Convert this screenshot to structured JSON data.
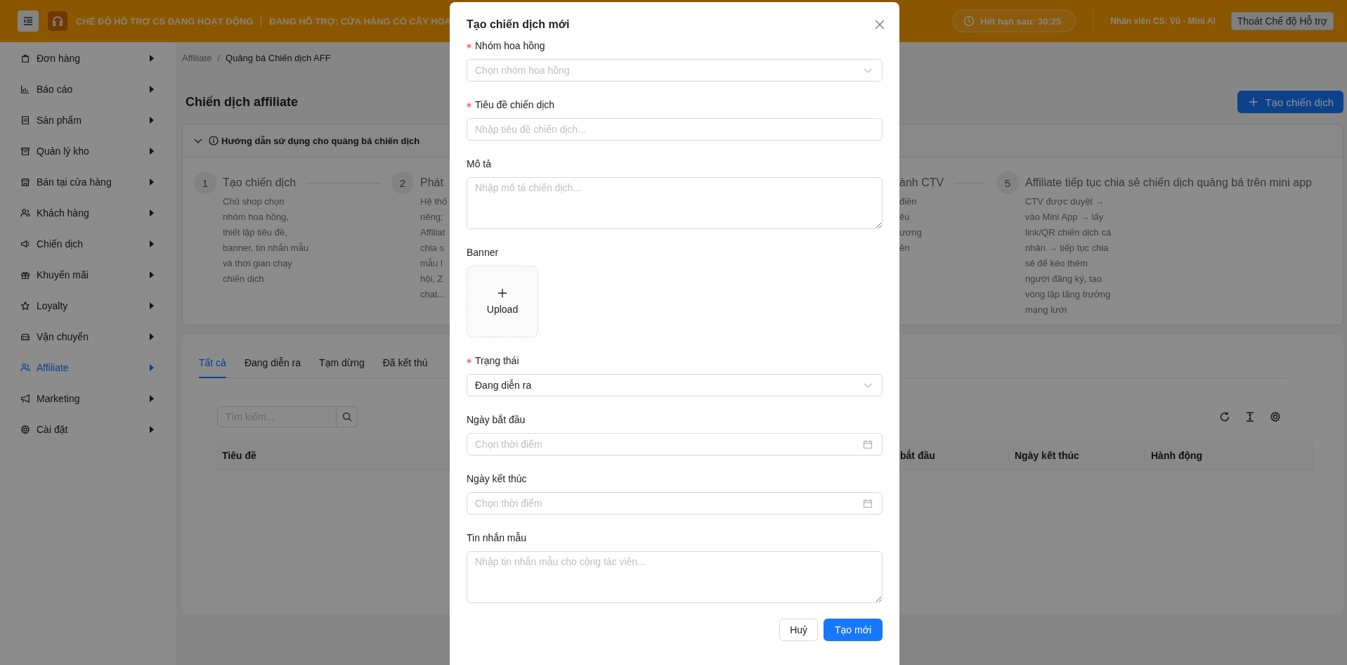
{
  "top_bar": {
    "mode_text": "CHẾ ĐỘ HỖ TRỢ CS ĐANG HOẠT ĐỘNG",
    "supporting_text": "ĐANG HỖ TRỢ: CỬA HÀNG CÒ CÂY HOA",
    "timer": "Hết hạn sau: 30:25",
    "staff": "Nhân viên CS: Vũ - Mini AI",
    "exit_button": "Thoát Chế độ Hỗ trợ"
  },
  "sidebar": {
    "items": [
      {
        "label": "Đơn hàng",
        "selected": false
      },
      {
        "label": "Báo cáo",
        "selected": false
      },
      {
        "label": "Sản phẩm",
        "selected": false
      },
      {
        "label": "Quản lý kho",
        "selected": false
      },
      {
        "label": "Bán tại cửa hàng",
        "selected": false
      },
      {
        "label": "Khách hàng",
        "selected": false
      },
      {
        "label": "Chiến dịch",
        "selected": false
      },
      {
        "label": "Khuyến mãi",
        "selected": false
      },
      {
        "label": "Loyalty",
        "selected": false
      },
      {
        "label": "Vận chuyển",
        "selected": false
      },
      {
        "label": "Affiliate",
        "selected": true
      },
      {
        "label": "Marketing",
        "selected": false
      },
      {
        "label": "Cài đặt",
        "selected": false
      }
    ]
  },
  "breadcrumb": [
    "Affiliate",
    "Quảng bá Chiến dịch AFF"
  ],
  "breadcrumb_separator": "/",
  "page_title": "Chiến dịch affiliate",
  "create_button": "Tạo chiến dịch",
  "guide": {
    "title": "Hướng dẫn sử dụng cho quảng bá chiến dịch",
    "expanded": true,
    "steps": [
      {
        "number": "1",
        "title": "Tạo chiến dịch",
        "lines": [
          "Chủ shop chọn",
          "nhóm hoa hồng,",
          "thiết lập tiêu đề,",
          "banner, tin nhắn mẫu",
          "và thời gian chạy",
          "chiến dịch"
        ]
      },
      {
        "number": "2",
        "title": "Phát",
        "lines": [
          "Hệ thố",
          "riêng;",
          "Affiliat",
          "chia s",
          "mẫu l",
          "hội, Z",
          "chat..."
        ]
      },
      {
        "title": "ành CTV",
        "lines": [
          "điền",
          "êu",
          "ương",
          "ên"
        ]
      },
      {
        "number": "5",
        "title": "Affiliate tiếp tục chia sẻ chiến dịch quảng bá trên mini app",
        "lines": [
          "CTV được duyệt →",
          "vào Mini App → lấy",
          "link/QR chiến dịch cá",
          "nhân → tiếp tục chia",
          "sẻ để kéo thêm",
          "người đăng ký, tạo",
          "vòng lặp tăng trưởng",
          "mạng lưới"
        ]
      }
    ]
  },
  "tabs": [
    {
      "label": "Tất cả",
      "selected": true
    },
    {
      "label": "Đang diễn ra",
      "selected": false
    },
    {
      "label": "Tạm dừng",
      "selected": false
    },
    {
      "label": "Đã kết thú",
      "selected": false
    }
  ],
  "search": {
    "placeholder": "Tìm kiếm..."
  },
  "table": {
    "columns": [
      "Tiêu đề",
      "bắt đầu",
      "Ngày kết thúc",
      "Hành động"
    ]
  },
  "modal": {
    "title": "Tạo chiến dịch mới",
    "fields": [
      {
        "kind": "select",
        "label": "Nhóm hoa hồng",
        "required": true,
        "placeholder": "Chọn nhóm hoa hồng"
      },
      {
        "kind": "input",
        "label": "Tiêu đề chiến dịch",
        "required": true,
        "placeholder": "Nhập tiêu đề chiến dịch..."
      },
      {
        "kind": "textarea",
        "label": "Mô tả",
        "required": false,
        "placeholder": "Nhập mô tả chiến dịch..."
      },
      {
        "kind": "upload",
        "label": "Banner",
        "required": false,
        "button": "Upload"
      },
      {
        "kind": "select",
        "label": "Trạng thái",
        "required": true,
        "value": "Đang diễn ra"
      },
      {
        "kind": "date",
        "label": "Ngày bắt đầu",
        "required": false,
        "placeholder": "Chọn thời điểm"
      },
      {
        "kind": "date",
        "label": "Ngày kết thúc",
        "required": false,
        "placeholder": "Chọn thời điểm"
      },
      {
        "kind": "textarea",
        "label": "Tin nhắn mẫu",
        "required": false,
        "placeholder": "Nhập tin nhắn mẫu cho cộng tác viên..."
      }
    ],
    "cancel_button": "Huỷ",
    "submit_button": "Tạo mới"
  }
}
